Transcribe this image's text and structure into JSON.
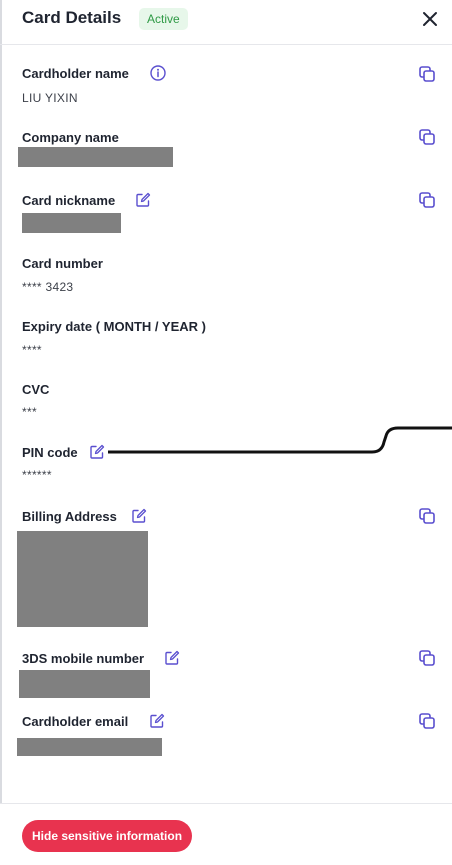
{
  "header": {
    "title": "Card Details",
    "status": "Active"
  },
  "fields": {
    "cardholder_name": {
      "label": "Cardholder name",
      "value": "LIU YIXIN"
    },
    "company_name": {
      "label": "Company name"
    },
    "card_nickname": {
      "label": "Card nickname"
    },
    "card_number": {
      "label": "Card number",
      "value": "**** 3423"
    },
    "expiry": {
      "label": "Expiry date ( MONTH / YEAR )",
      "value": "****"
    },
    "cvc": {
      "label": "CVC",
      "value": "***"
    },
    "pin": {
      "label": "PIN code",
      "value": "******"
    },
    "billing": {
      "label": "Billing Address"
    },
    "mobile": {
      "label": "3DS mobile number"
    },
    "email": {
      "label": "Cardholder email"
    }
  },
  "footer": {
    "hide_label": "Hide sensitive information"
  },
  "icons": {
    "info": "info-icon",
    "edit": "edit-icon",
    "copy": "copy-icon",
    "close": "close-icon"
  },
  "colors": {
    "accent": "#5a4fcf",
    "badge_bg": "#e7f7ea",
    "badge_text": "#2e9a45",
    "button": "#e8334f",
    "redaction": "#808080"
  }
}
